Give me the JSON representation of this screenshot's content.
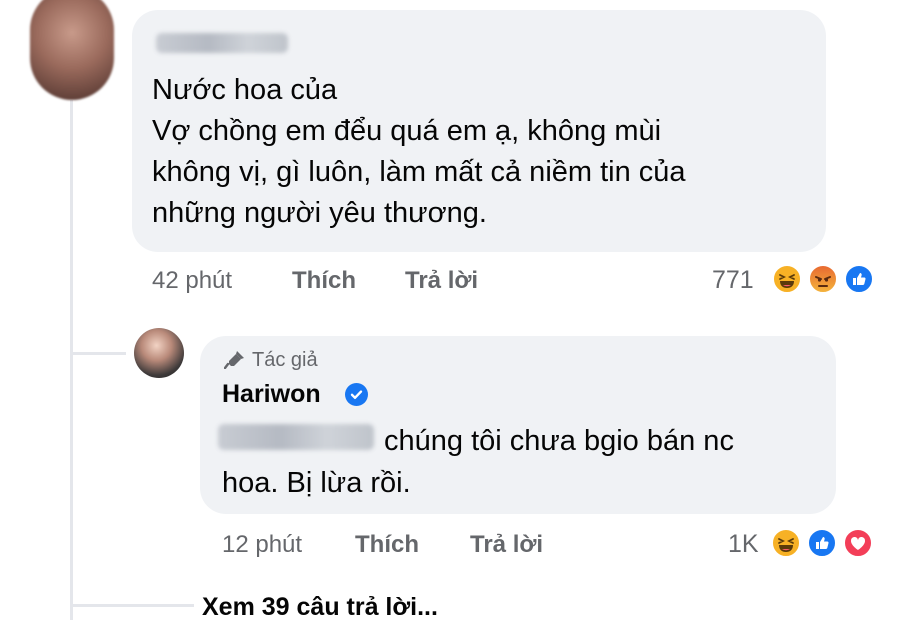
{
  "comment": {
    "author_name": "",
    "text_lines": [
      "Nước hoa của",
      "Vợ chồng em đểu quá em ạ, không mùi",
      "không vị, gì luôn, làm mất cả niềm tin của",
      "những người yêu thương."
    ],
    "time": "42 phút",
    "like_label": "Thích",
    "reply_label": "Trả lời",
    "reaction_count": "771",
    "reactions": [
      "haha-icon",
      "angry-icon",
      "like-icon"
    ]
  },
  "reply": {
    "badge_label": "Tác giả",
    "author_name": "Hariwon",
    "verified": true,
    "text_line_1": "chúng tôi chưa bgio bán nc",
    "text_line_2": "hoa. Bị lừa rồi.",
    "time": "12 phút",
    "like_label": "Thích",
    "reply_label": "Trả lời",
    "reaction_count": "1K",
    "reactions": [
      "haha-icon",
      "like-icon",
      "love-icon"
    ]
  },
  "view_more_replies": "Xem 39 câu trả lời...",
  "colors": {
    "bubble": "#f0f2f5",
    "meta_text": "#65676b",
    "like_blue": "#1877f2",
    "haha_yellow": "#f7b125",
    "love_red": "#f33e58"
  }
}
